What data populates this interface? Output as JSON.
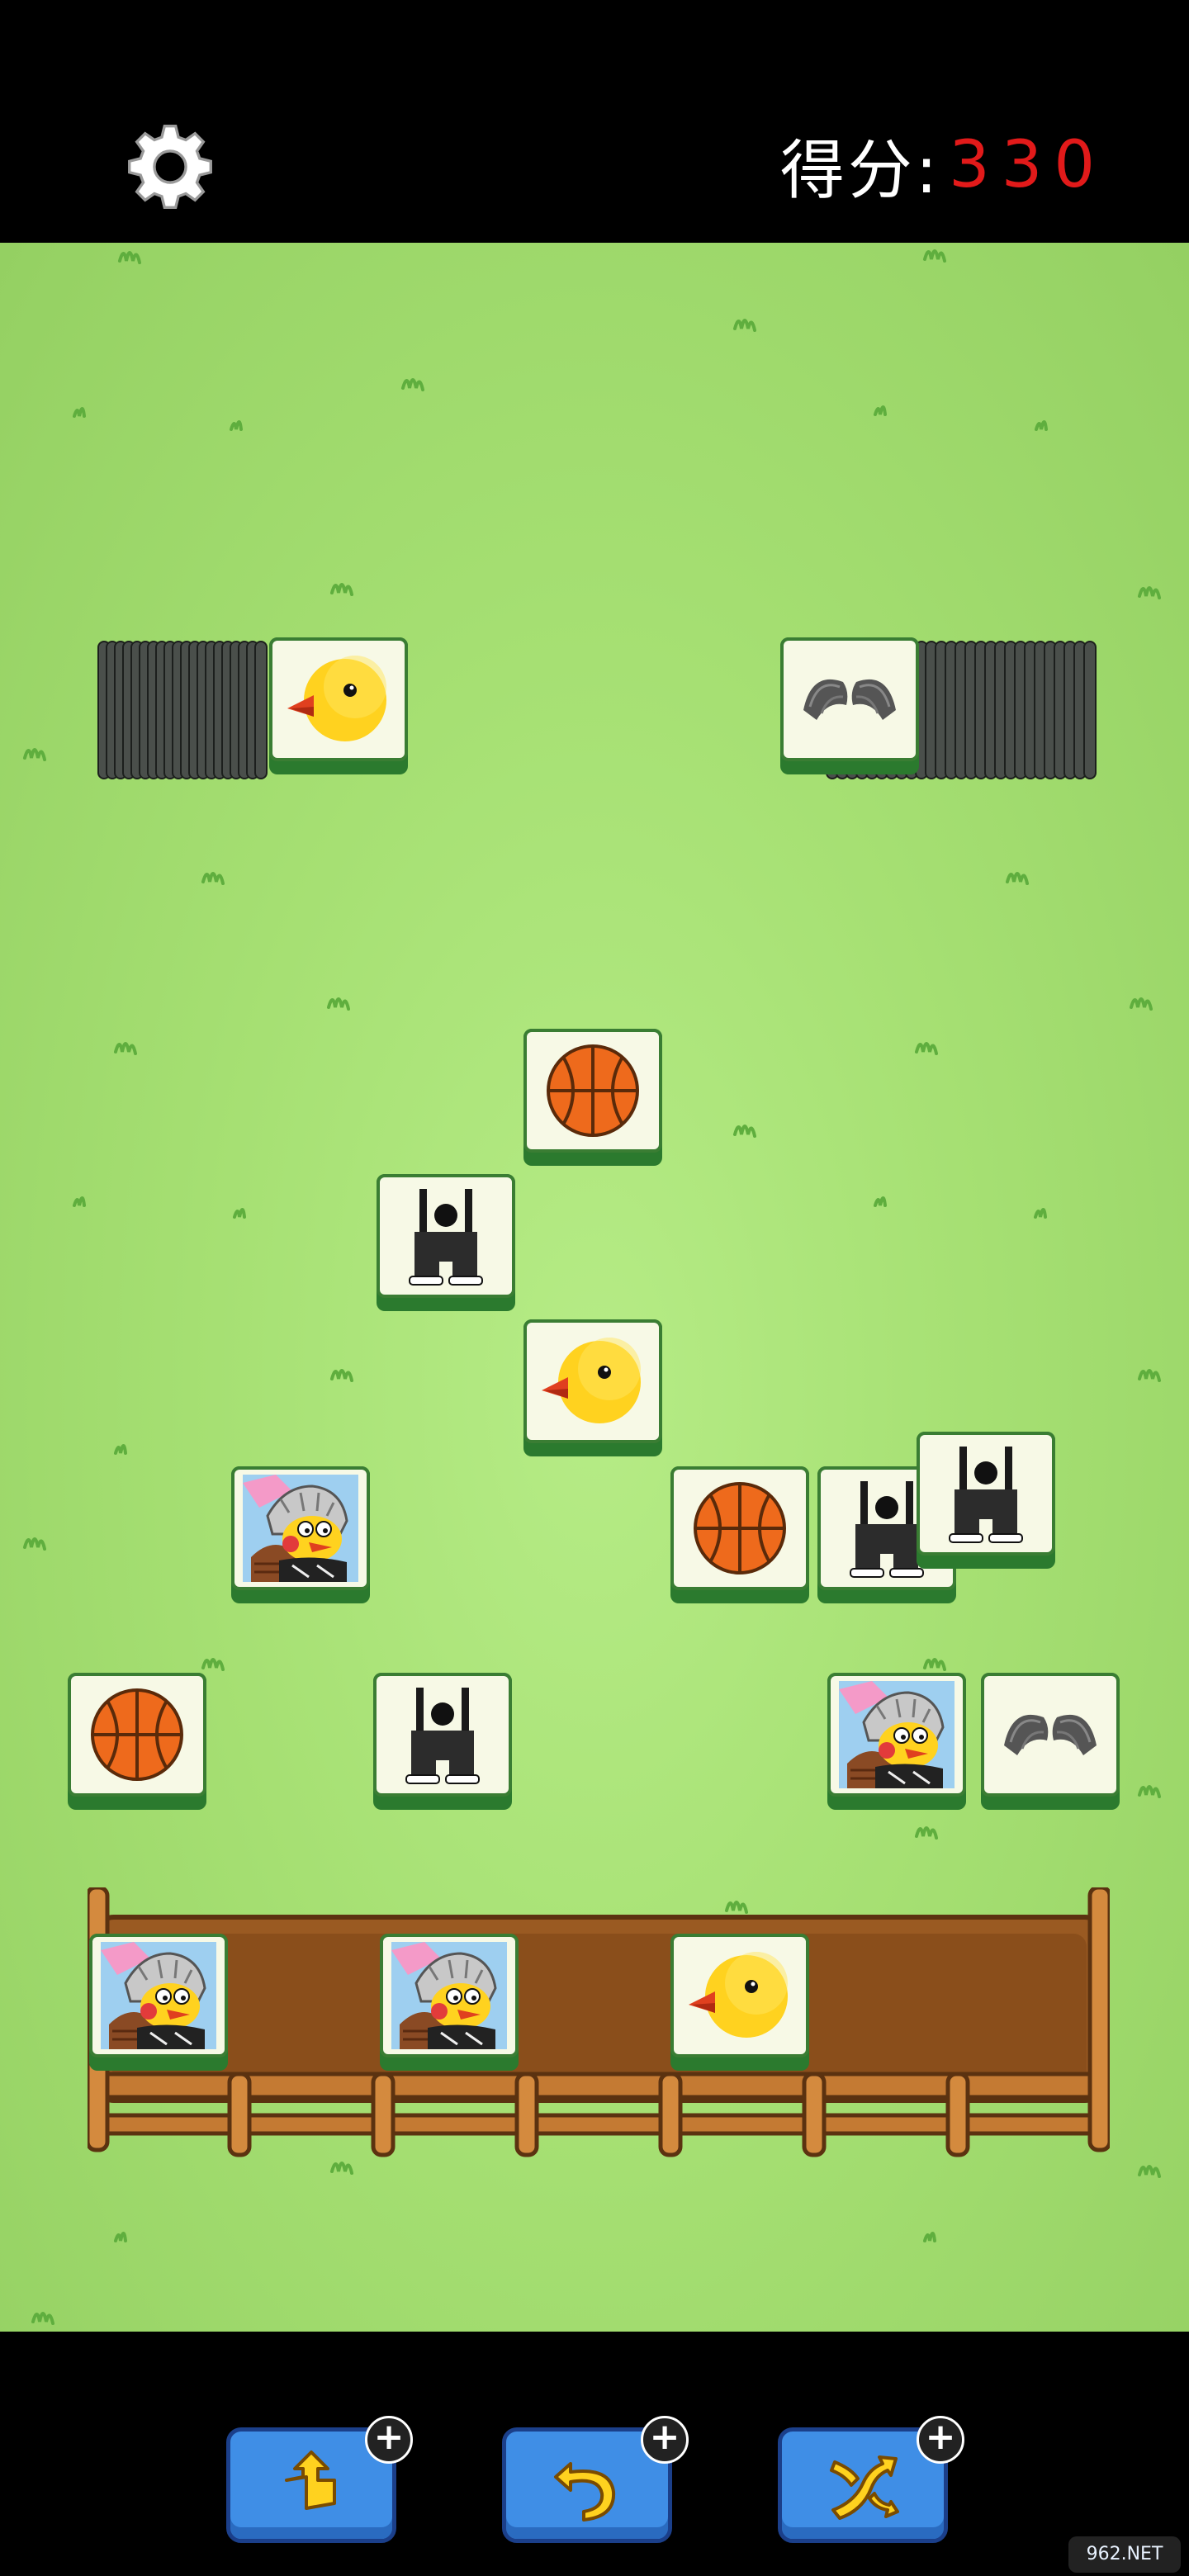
{
  "header": {
    "settings_icon": "gear-icon",
    "score_label": "得分:",
    "score_value": "330"
  },
  "tiles_board": [
    "chick",
    "charm",
    "basketball",
    "overalls",
    "chick",
    "character",
    "basketball",
    "overalls",
    "overalls",
    "basketball",
    "overalls",
    "character",
    "charm"
  ],
  "slot_tray": [
    "character",
    "character",
    "chick"
  ],
  "powerups": [
    {
      "name": "move-out",
      "icon": "move-out-icon",
      "badge": "+"
    },
    {
      "name": "undo",
      "icon": "undo-icon",
      "badge": "+"
    },
    {
      "name": "shuffle",
      "icon": "shuffle-icon",
      "badge": "+"
    }
  ],
  "watermark": "962.NET",
  "colors": {
    "score_value": "#e21a1a",
    "tile_face": "#f7f9e6",
    "tile_base": "#3a7d33",
    "button": "#3f8ee6",
    "tray": "#9a5a22"
  }
}
